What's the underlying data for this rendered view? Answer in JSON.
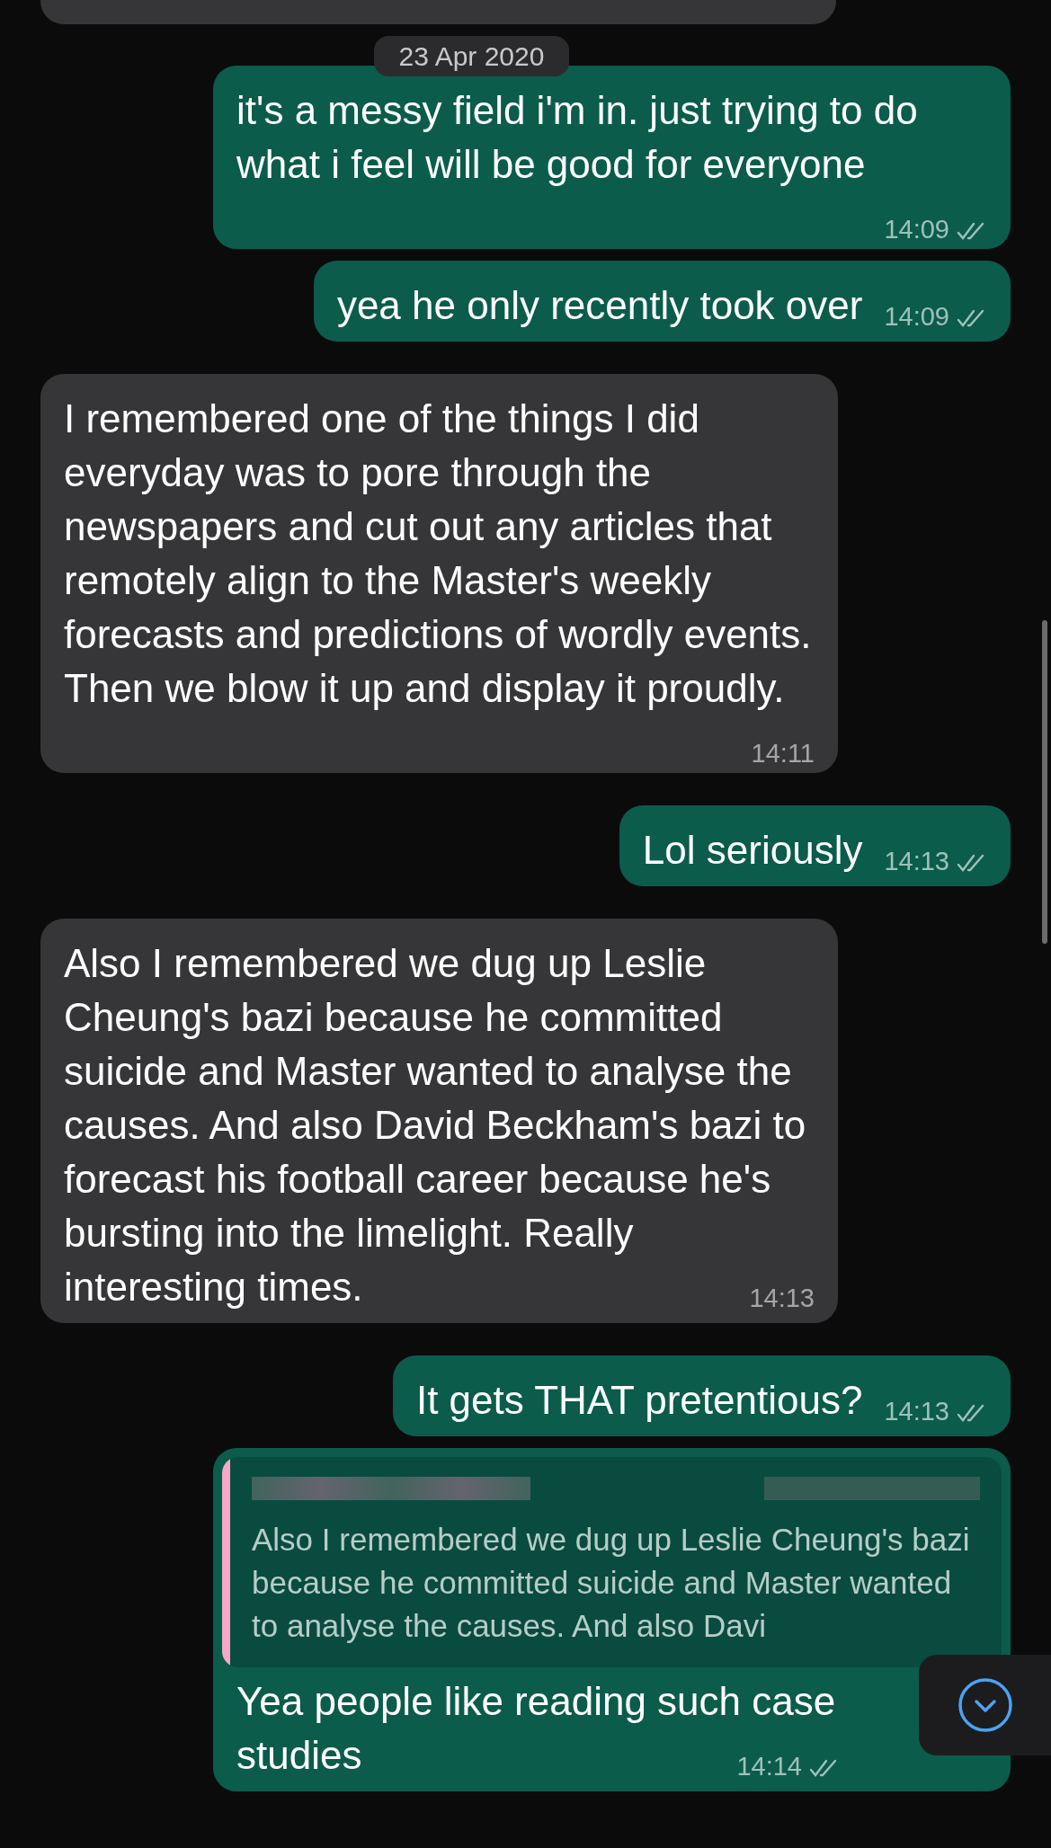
{
  "date_chip": "23 Apr 2020",
  "messages": [
    {
      "kind": "outgoing",
      "text": "it's a messy field i'm in. just trying to do what i feel will be good for everyone",
      "time": "14:09"
    },
    {
      "kind": "outgoing",
      "text": "yea he only recently took over",
      "time": "14:09"
    },
    {
      "kind": "incoming",
      "text": "I remembered one of the things I did everyday was to pore through the newspapers and cut out any articles that remotely align to the Master's weekly forecasts and predictions of wordly events. Then we blow it up and display it proudly.",
      "time": "14:11"
    },
    {
      "kind": "outgoing",
      "text": "Lol seriously",
      "time": "14:13"
    },
    {
      "kind": "incoming",
      "text": "Also I remembered we dug up Leslie Cheung's bazi because he committed suicide and Master wanted to analyse the causes. And also David Beckham's bazi to forecast his football career because he's bursting into the limelight. Really interesting times.",
      "time": "14:13"
    },
    {
      "kind": "outgoing",
      "text": "It gets THAT pretentious?",
      "time": "14:13"
    },
    {
      "kind": "outgoing",
      "quote": "Also I remembered we dug up Leslie Cheung's bazi because he committed suicide and Master wanted to analyse the causes. And also Davi",
      "text": "Yea people like reading such case studies",
      "time": "14:14"
    }
  ]
}
